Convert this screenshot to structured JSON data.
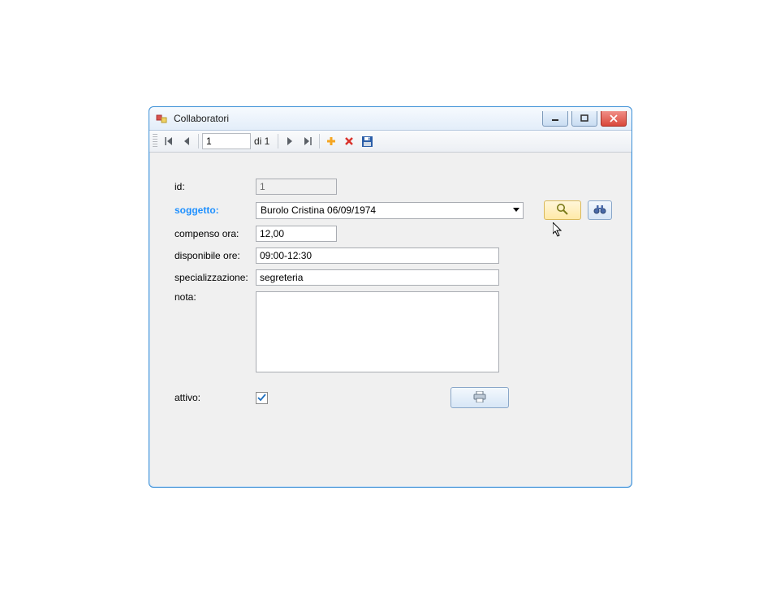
{
  "window": {
    "title": "Collaboratori"
  },
  "nav": {
    "position": "1",
    "of_label": "di 1"
  },
  "labels": {
    "id": "id:",
    "soggetto": "soggetto:",
    "compenso": "compenso ora:",
    "disponibile": "disponibile ore:",
    "specializzazione": "specializzazione:",
    "nota": "nota:",
    "attivo": "attivo:"
  },
  "values": {
    "id": "1",
    "soggetto": "Burolo Cristina 06/09/1974",
    "compenso": "12,00",
    "disponibile": "09:00-12:30",
    "specializzazione": "segreteria",
    "nota": "",
    "attivo": true
  }
}
